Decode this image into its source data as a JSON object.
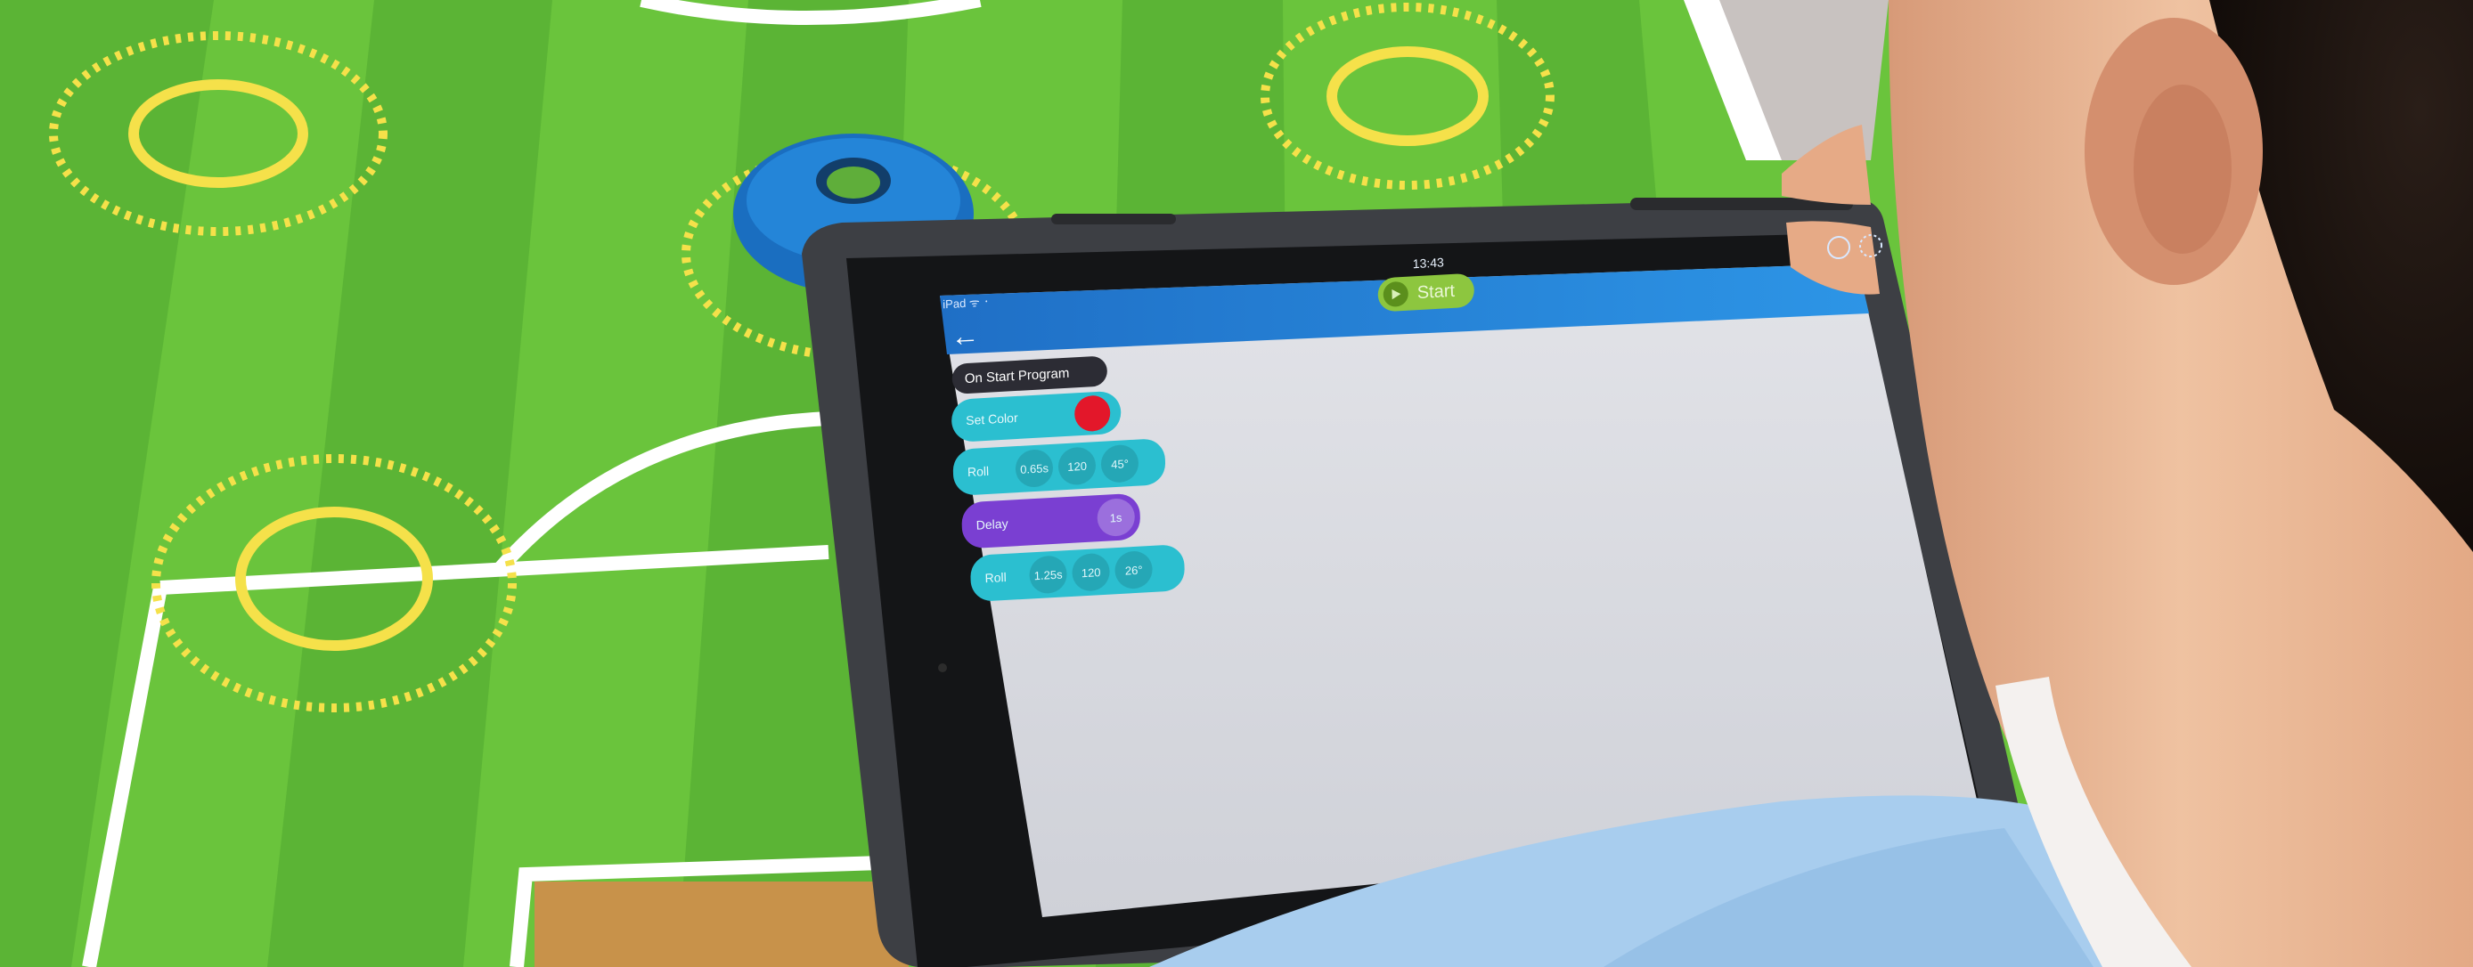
{
  "ipad": {
    "status_left": "iPad ᯤ ᛫",
    "status_time": "13:43",
    "start_label": "Start",
    "back_icon": "arrow-left-icon",
    "play_icon": "play-icon"
  },
  "program": {
    "hat_label": "On Start Program",
    "blocks": [
      {
        "label": "Set Color",
        "params": []
      },
      {
        "label": "Roll",
        "params": [
          "0.65s",
          "120",
          "45°"
        ]
      },
      {
        "label": "Delay",
        "params": [
          "1s"
        ]
      },
      {
        "label": "Roll",
        "params": [
          "1.25s",
          "120",
          "26°"
        ]
      }
    ]
  },
  "colors": {
    "field_green": "#68c23a",
    "field_dark_green": "#4aa62c",
    "line_yellow": "#f6e24a",
    "cone_blue": "#1e79c8",
    "tablet_case": "#3b3d41",
    "app_header_blue": "#2a8fe0",
    "canvas_grey": "#d7d8dd",
    "block_teal": "#2bbfd0",
    "block_purple": "#7a3fd2",
    "color_red": "#e3172a",
    "sweater_blue": "#9ec6ea",
    "skin": "#e8b38f"
  }
}
